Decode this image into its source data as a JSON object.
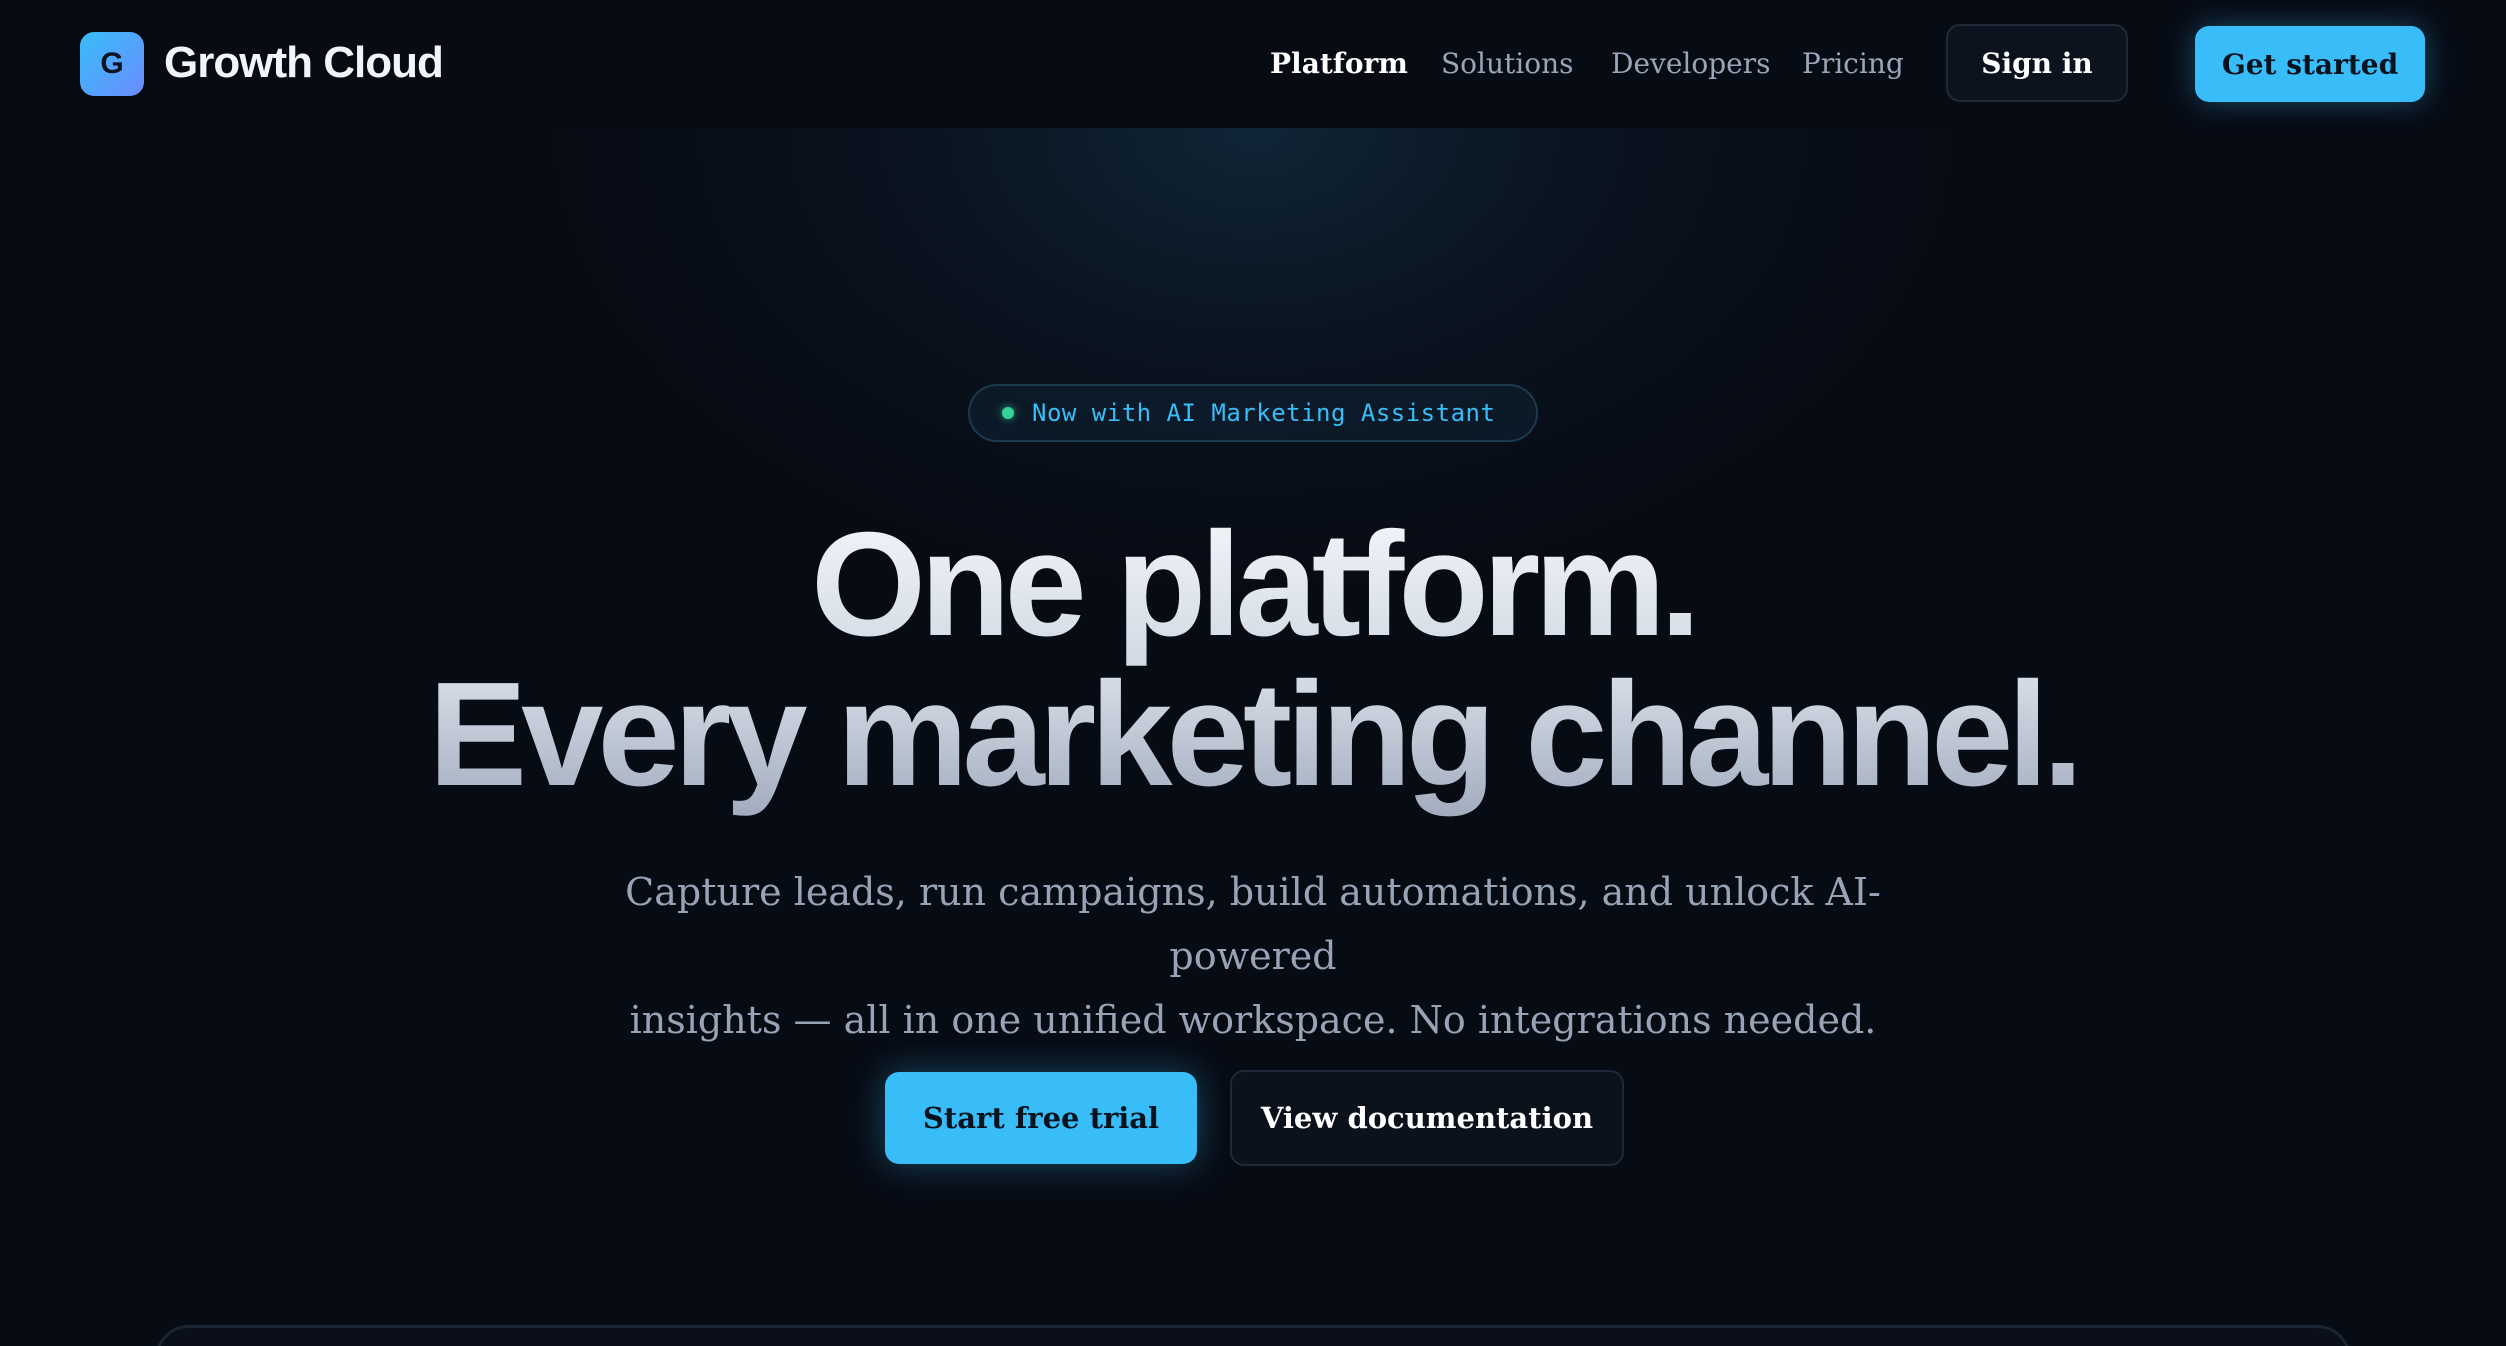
{
  "header": {
    "logo_letter": "G",
    "brand": "Growth Cloud",
    "nav": [
      {
        "label": "Platform",
        "active": true
      },
      {
        "label": "Solutions",
        "active": false
      },
      {
        "label": "Developers",
        "active": false
      },
      {
        "label": "Pricing",
        "active": false
      }
    ],
    "sign_in": "Sign in",
    "get_started": "Get started"
  },
  "hero": {
    "badge": "Now with AI Marketing Assistant",
    "headline_line1": "One platform.",
    "headline_line2": "Every marketing channel.",
    "subtitle_line1": "Capture leads, run campaigns, build automations, and unlock AI-powered",
    "subtitle_line2": "insights — all in one unified workspace. No integrations needed.",
    "cta_primary": "Start free trial",
    "cta_secondary": "View documentation"
  },
  "colors": {
    "accent": "#38bdf8",
    "background": "#070b14",
    "badge_dot": "#34d399"
  }
}
